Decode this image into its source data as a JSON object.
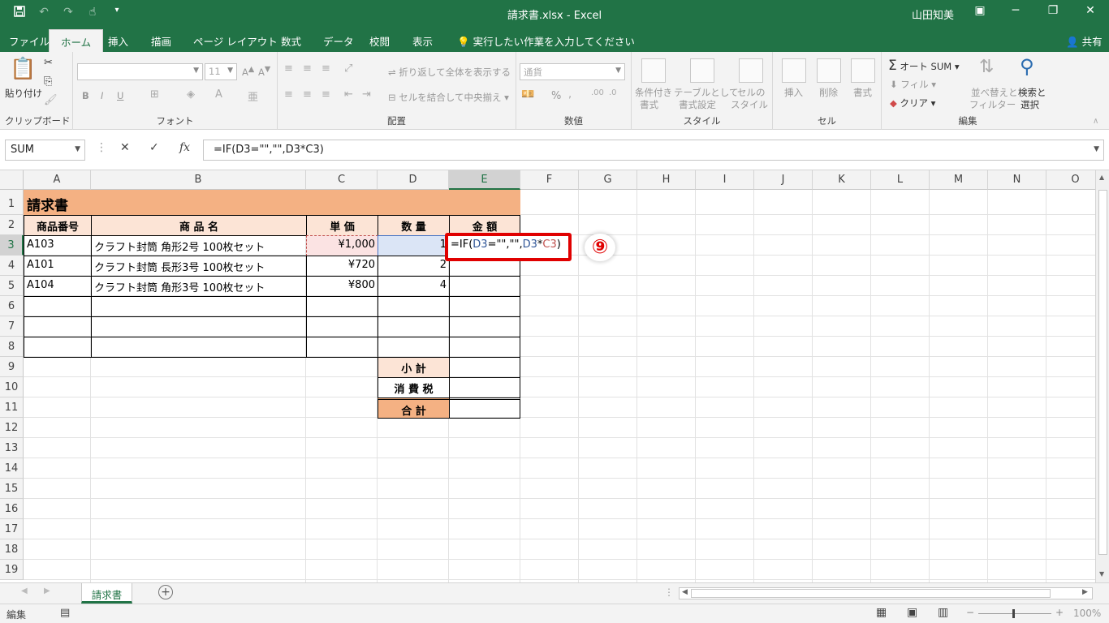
{
  "window": {
    "title": "請求書.xlsx - Excel",
    "user": "山田知美",
    "share_label": "共有"
  },
  "qat": {
    "save_icon": "save-icon",
    "undo_icon": "undo-icon",
    "redo_icon": "redo-icon",
    "touch_icon": "touch-mode-icon"
  },
  "tabs": [
    {
      "label": "ファイル"
    },
    {
      "label": "ホーム",
      "active": true
    },
    {
      "label": "挿入"
    },
    {
      "label": "描画"
    },
    {
      "label": "ページ レイアウト"
    },
    {
      "label": "数式"
    },
    {
      "label": "データ"
    },
    {
      "label": "校閲"
    },
    {
      "label": "表示"
    },
    {
      "label": "実行したい作業を入力してください"
    }
  ],
  "ribbon": {
    "clipboard": {
      "paste": "貼り付け",
      "label": "クリップボード"
    },
    "font": {
      "size": "11",
      "bold": "B",
      "italic": "I",
      "underline": "U",
      "label": "フォント"
    },
    "alignment": {
      "wrap": "折り返して全体を表示する",
      "merge": "セルを結合して中央揃え",
      "label": "配置"
    },
    "number": {
      "format": "通貨",
      "percent": "%",
      "label": "数値"
    },
    "styles": {
      "conditional_1": "条件付き",
      "conditional_2": "書式",
      "table_1": "テーブルとして",
      "table_2": "書式設定",
      "cell_1": "セルの",
      "cell_2": "スタイル",
      "label": "スタイル"
    },
    "cells": {
      "insert": "挿入",
      "delete": "削除",
      "format": "書式",
      "label": "セル"
    },
    "editing": {
      "autosum": "オート SUM",
      "fill": "フィル",
      "clear": "クリア",
      "sort_1": "並べ替えと",
      "sort_2": "フィルター",
      "find_1": "検索と",
      "find_2": "選択",
      "label": "編集"
    }
  },
  "formula_bar": {
    "name_box": "SUM",
    "fx": "fx",
    "formula": "=IF(D3=\"\",\"\",D3*C3)"
  },
  "columns": [
    "A",
    "B",
    "C",
    "D",
    "E",
    "F",
    "G",
    "H",
    "I",
    "J",
    "K",
    "L",
    "M",
    "N",
    "O"
  ],
  "rows": [
    "1",
    "2",
    "3",
    "4",
    "5",
    "6",
    "7",
    "8",
    "9",
    "10",
    "11",
    "12",
    "13",
    "14",
    "15",
    "16",
    "17",
    "18",
    "19"
  ],
  "sheet": {
    "title": "請求書",
    "headers": {
      "code": "商品番号",
      "name": "商 品 名",
      "price": "単 価",
      "qty": "数 量",
      "amount": "金 額"
    },
    "items": [
      {
        "code": "A103",
        "name": "クラフト封筒 角形2号 100枚セット",
        "price": "¥1,000",
        "qty": "1"
      },
      {
        "code": "A101",
        "name": "クラフト封筒 長形3号 100枚セット",
        "price": "¥720",
        "qty": "2"
      },
      {
        "code": "A104",
        "name": "クラフト封筒 角形3号 100枚セット",
        "price": "¥800",
        "qty": "4"
      }
    ],
    "subtotal": "小 計",
    "tax": "消 費 税",
    "total": "合 計",
    "editing_cell": {
      "p1": "=IF(",
      "p2": "D3",
      "p3": "=\"\",\"\",",
      "p4": "D3",
      "p5": "*",
      "p6": "C3",
      "p7": ")"
    },
    "annotation": "⑨"
  },
  "sheet_tabs": [
    {
      "label": "請求書"
    }
  ],
  "status": {
    "mode": "編集",
    "zoom": "100%"
  },
  "colors": {
    "excel_green": "#217346",
    "title_fill": "#f4b183",
    "header_fill": "#fce4d6",
    "highlight_red": "#e00000"
  }
}
